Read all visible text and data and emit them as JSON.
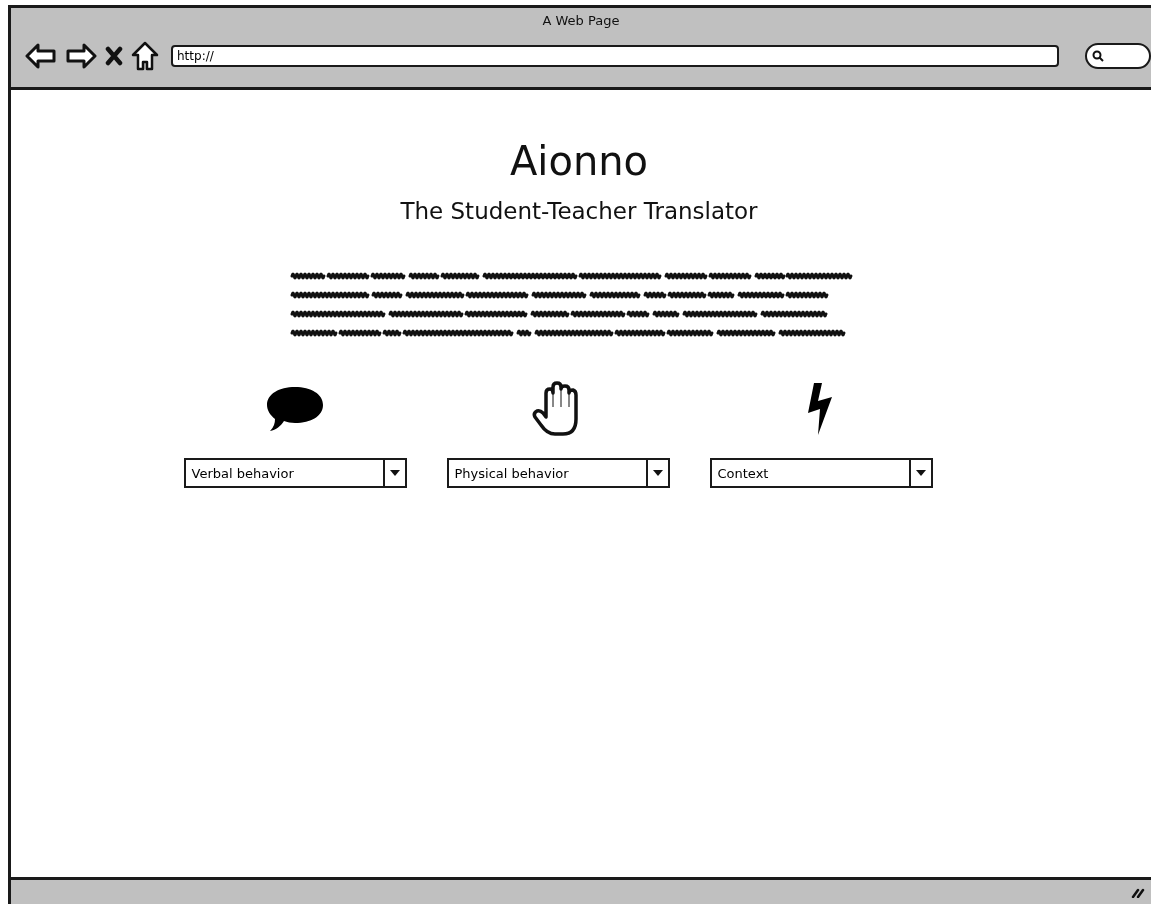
{
  "window": {
    "title": "A Web Page"
  },
  "address_bar": {
    "value": "http://"
  },
  "page": {
    "title": "Aionno",
    "subtitle": "The Student-Teacher Translator",
    "selectors": [
      {
        "kind": "speech",
        "value": "Verbal behavior"
      },
      {
        "kind": "hand",
        "value": "Physical behavior"
      },
      {
        "kind": "lightning",
        "value": "Context"
      }
    ]
  }
}
